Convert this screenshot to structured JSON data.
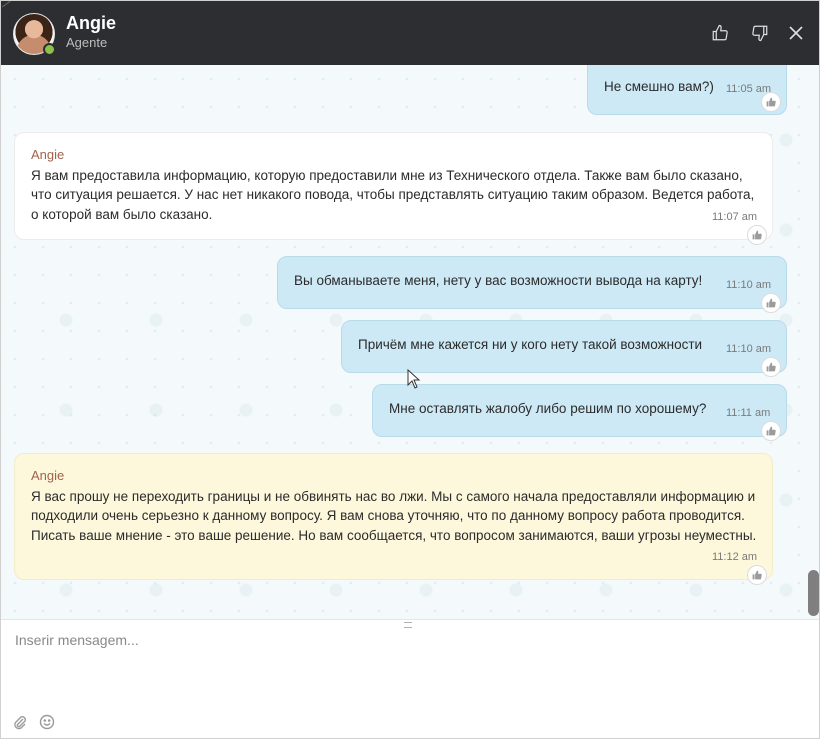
{
  "header": {
    "agent_name": "Angie",
    "agent_role": "Agente",
    "status_color": "#8bc34a",
    "icons": [
      "thumbs-up-icon",
      "thumbs-down-icon",
      "close-icon"
    ]
  },
  "messages": [
    {
      "direction": "out",
      "text": "Не смешно вам?)",
      "time": "11:05 am"
    },
    {
      "direction": "in",
      "sender": "Angie",
      "text": "Я вам предоставила информацию, которую предоставили мне из Технического отдела. Также вам было сказано, что ситуация решается. У  нас нет никакого повода, чтобы представлять ситуацию таким образом. Ведется работа, о которой вам было сказано.",
      "time": "11:07 am"
    },
    {
      "direction": "out",
      "text": "Вы обманываете меня, нету у вас возможности вывода на карту!",
      "time": "11:10 am"
    },
    {
      "direction": "out",
      "text": "Причём мне кажется ни у кого нету такой возможности",
      "time": "11:10 am"
    },
    {
      "direction": "out",
      "text": "Мне оставлять жалобу либо решим по хорошему?",
      "time": "11:11 am"
    },
    {
      "direction": "in",
      "sender": "Angie",
      "text": "Я вас прошу не переходить границы и не обвинять нас во лжи. Мы с самого начала предоставляли информацию и подходили очень серьезно к данному вопросу. Я вам снова уточняю, что по данному вопросу работа проводится. Писать ваше мнение - это ваше решение. Но вам сообщается, что вопросом занимаются, ваши угрозы неуместны.",
      "time": "11:12 am"
    }
  ],
  "composer": {
    "placeholder": "Inserir mensagem...",
    "value": "",
    "icons": [
      "paperclip-icon",
      "emoji-icon"
    ]
  },
  "colors": {
    "header_bg": "#2c2e31",
    "outgoing_bubble": "#cde9f6",
    "incoming_bubble": "#ffffff",
    "highlighted_bubble": "#fdf7dc",
    "sender_name": "#a1634b"
  }
}
